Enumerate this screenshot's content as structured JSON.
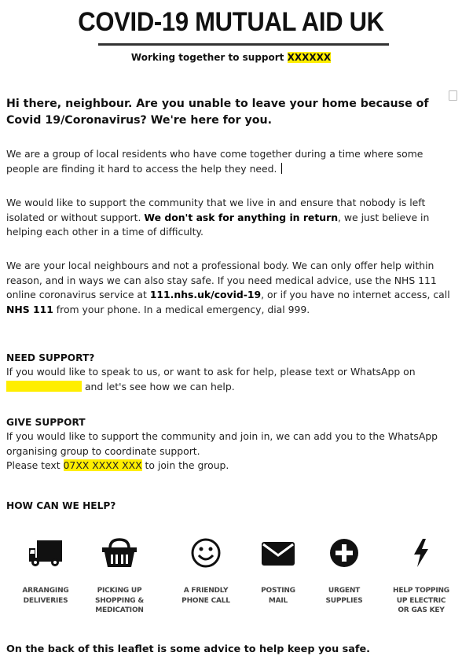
{
  "header": {
    "title": "COVID-19 MUTUAL AID UK",
    "subtitle_prefix": "Working together to support ",
    "subtitle_highlight": "XXXXXX"
  },
  "intro": {
    "headline": "Hi there, neighbour. Are you unable to leave your home because of Covid 19/Coronavirus? We're here for you.",
    "p1": "We are a group of local residents who have come together during a time where some people are finding it hard to access the help they need.",
    "p2_a": "We would like to support the community that we live in and ensure that nobody is left isolated or without support. ",
    "p2_bold": "We don't ask for anything in return",
    "p2_b": ", we just believe in helping each other in a time of difficulty.",
    "p3_a": "We are your local neighbours and not a professional body. We can only offer help within reason, and in ways we can also stay safe. If you need medical advice, use the NHS 111 online coronavirus service at ",
    "p3_link": "111.nhs.uk/covid-19",
    "p3_b": ", or if you have no internet access, call ",
    "p3_nhs": "NHS 111",
    "p3_c": " from your phone. In a medical emergency, dial 999."
  },
  "need_support": {
    "heading": "NEED SUPPORT?",
    "text_a": "If you would like to speak to us, or want to ask for help, please text or WhatsApp on ",
    "text_b": " and let's see how we can help."
  },
  "give_support": {
    "heading": "GIVE SUPPORT",
    "text": "If you would like to support the community and join in, we can add you to the WhatsApp organising group to coordinate support.",
    "line2_a": "Please text ",
    "phone": "07XX XXXX XXX",
    "line2_b": " to join the group."
  },
  "help": {
    "heading": "HOW CAN WE HELP?",
    "items": [
      {
        "icon": "truck-icon",
        "label": "ARRANGING\nDELIVERIES"
      },
      {
        "icon": "shopping-basket-icon",
        "label": "PICKING UP\nSHOPPING &\nMEDICATION"
      },
      {
        "icon": "smiley-icon",
        "label": "A FRIENDLY\nPHONE CALL"
      },
      {
        "icon": "envelope-icon",
        "label": "POSTING\nMAIL"
      },
      {
        "icon": "plus-circle-icon",
        "label": "URGENT\nSUPPLIES"
      },
      {
        "icon": "lightning-bolt-icon",
        "label": "HELP TOPPING\nUP ELECTRIC\nOR GAS KEY"
      }
    ]
  },
  "footer": "On the back of this leaflet is some advice to help keep you safe.",
  "colors": {
    "highlight": "#ffee00",
    "text": "#111111"
  }
}
